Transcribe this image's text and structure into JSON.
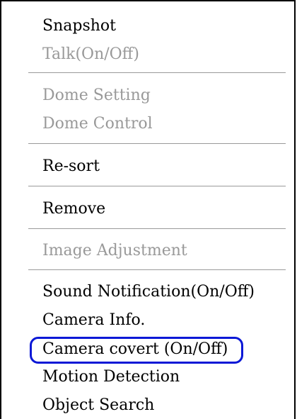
{
  "menu": {
    "items": [
      {
        "label": "Snapshot",
        "enabled": true
      },
      {
        "label": "Talk(On/Off)",
        "enabled": false
      },
      {
        "label": "Dome Setting",
        "enabled": false
      },
      {
        "label": "Dome Control",
        "enabled": false
      },
      {
        "label": "Re-sort",
        "enabled": true
      },
      {
        "label": "Remove",
        "enabled": true
      },
      {
        "label": "Image Adjustment",
        "enabled": false
      },
      {
        "label": "Sound Notification(On/Off)",
        "enabled": true
      },
      {
        "label": "Camera Info.",
        "enabled": true
      },
      {
        "label": "Camera covert (On/Off)",
        "enabled": true,
        "highlighted": true
      },
      {
        "label": "Motion Detection",
        "enabled": true
      },
      {
        "label": "Object Search",
        "enabled": true
      }
    ]
  },
  "colors": {
    "enabled_text": "#000000",
    "disabled_text": "#999999",
    "highlight_outline": "#0a18d6"
  }
}
